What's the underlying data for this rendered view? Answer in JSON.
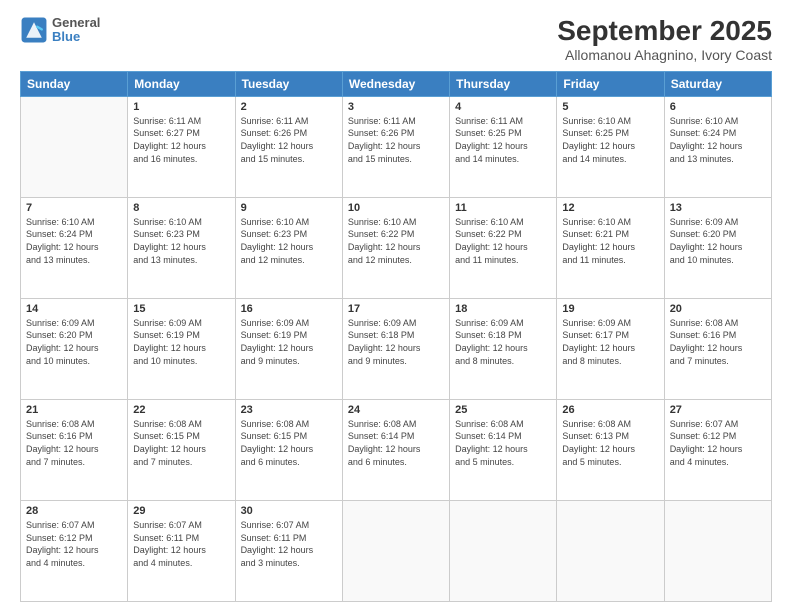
{
  "logo": {
    "line1": "General",
    "line2": "Blue"
  },
  "title": "September 2025",
  "subtitle": "Allomanou Ahagnino, Ivory Coast",
  "weekdays": [
    "Sunday",
    "Monday",
    "Tuesday",
    "Wednesday",
    "Thursday",
    "Friday",
    "Saturday"
  ],
  "weeks": [
    [
      {
        "day": "",
        "info": ""
      },
      {
        "day": "1",
        "info": "Sunrise: 6:11 AM\nSunset: 6:27 PM\nDaylight: 12 hours\nand 16 minutes."
      },
      {
        "day": "2",
        "info": "Sunrise: 6:11 AM\nSunset: 6:26 PM\nDaylight: 12 hours\nand 15 minutes."
      },
      {
        "day": "3",
        "info": "Sunrise: 6:11 AM\nSunset: 6:26 PM\nDaylight: 12 hours\nand 15 minutes."
      },
      {
        "day": "4",
        "info": "Sunrise: 6:11 AM\nSunset: 6:25 PM\nDaylight: 12 hours\nand 14 minutes."
      },
      {
        "day": "5",
        "info": "Sunrise: 6:10 AM\nSunset: 6:25 PM\nDaylight: 12 hours\nand 14 minutes."
      },
      {
        "day": "6",
        "info": "Sunrise: 6:10 AM\nSunset: 6:24 PM\nDaylight: 12 hours\nand 13 minutes."
      }
    ],
    [
      {
        "day": "7",
        "info": "Sunrise: 6:10 AM\nSunset: 6:24 PM\nDaylight: 12 hours\nand 13 minutes."
      },
      {
        "day": "8",
        "info": "Sunrise: 6:10 AM\nSunset: 6:23 PM\nDaylight: 12 hours\nand 13 minutes."
      },
      {
        "day": "9",
        "info": "Sunrise: 6:10 AM\nSunset: 6:23 PM\nDaylight: 12 hours\nand 12 minutes."
      },
      {
        "day": "10",
        "info": "Sunrise: 6:10 AM\nSunset: 6:22 PM\nDaylight: 12 hours\nand 12 minutes."
      },
      {
        "day": "11",
        "info": "Sunrise: 6:10 AM\nSunset: 6:22 PM\nDaylight: 12 hours\nand 11 minutes."
      },
      {
        "day": "12",
        "info": "Sunrise: 6:10 AM\nSunset: 6:21 PM\nDaylight: 12 hours\nand 11 minutes."
      },
      {
        "day": "13",
        "info": "Sunrise: 6:09 AM\nSunset: 6:20 PM\nDaylight: 12 hours\nand 10 minutes."
      }
    ],
    [
      {
        "day": "14",
        "info": "Sunrise: 6:09 AM\nSunset: 6:20 PM\nDaylight: 12 hours\nand 10 minutes."
      },
      {
        "day": "15",
        "info": "Sunrise: 6:09 AM\nSunset: 6:19 PM\nDaylight: 12 hours\nand 10 minutes."
      },
      {
        "day": "16",
        "info": "Sunrise: 6:09 AM\nSunset: 6:19 PM\nDaylight: 12 hours\nand 9 minutes."
      },
      {
        "day": "17",
        "info": "Sunrise: 6:09 AM\nSunset: 6:18 PM\nDaylight: 12 hours\nand 9 minutes."
      },
      {
        "day": "18",
        "info": "Sunrise: 6:09 AM\nSunset: 6:18 PM\nDaylight: 12 hours\nand 8 minutes."
      },
      {
        "day": "19",
        "info": "Sunrise: 6:09 AM\nSunset: 6:17 PM\nDaylight: 12 hours\nand 8 minutes."
      },
      {
        "day": "20",
        "info": "Sunrise: 6:08 AM\nSunset: 6:16 PM\nDaylight: 12 hours\nand 7 minutes."
      }
    ],
    [
      {
        "day": "21",
        "info": "Sunrise: 6:08 AM\nSunset: 6:16 PM\nDaylight: 12 hours\nand 7 minutes."
      },
      {
        "day": "22",
        "info": "Sunrise: 6:08 AM\nSunset: 6:15 PM\nDaylight: 12 hours\nand 7 minutes."
      },
      {
        "day": "23",
        "info": "Sunrise: 6:08 AM\nSunset: 6:15 PM\nDaylight: 12 hours\nand 6 minutes."
      },
      {
        "day": "24",
        "info": "Sunrise: 6:08 AM\nSunset: 6:14 PM\nDaylight: 12 hours\nand 6 minutes."
      },
      {
        "day": "25",
        "info": "Sunrise: 6:08 AM\nSunset: 6:14 PM\nDaylight: 12 hours\nand 5 minutes."
      },
      {
        "day": "26",
        "info": "Sunrise: 6:08 AM\nSunset: 6:13 PM\nDaylight: 12 hours\nand 5 minutes."
      },
      {
        "day": "27",
        "info": "Sunrise: 6:07 AM\nSunset: 6:12 PM\nDaylight: 12 hours\nand 4 minutes."
      }
    ],
    [
      {
        "day": "28",
        "info": "Sunrise: 6:07 AM\nSunset: 6:12 PM\nDaylight: 12 hours\nand 4 minutes."
      },
      {
        "day": "29",
        "info": "Sunrise: 6:07 AM\nSunset: 6:11 PM\nDaylight: 12 hours\nand 4 minutes."
      },
      {
        "day": "30",
        "info": "Sunrise: 6:07 AM\nSunset: 6:11 PM\nDaylight: 12 hours\nand 3 minutes."
      },
      {
        "day": "",
        "info": ""
      },
      {
        "day": "",
        "info": ""
      },
      {
        "day": "",
        "info": ""
      },
      {
        "day": "",
        "info": ""
      }
    ]
  ]
}
